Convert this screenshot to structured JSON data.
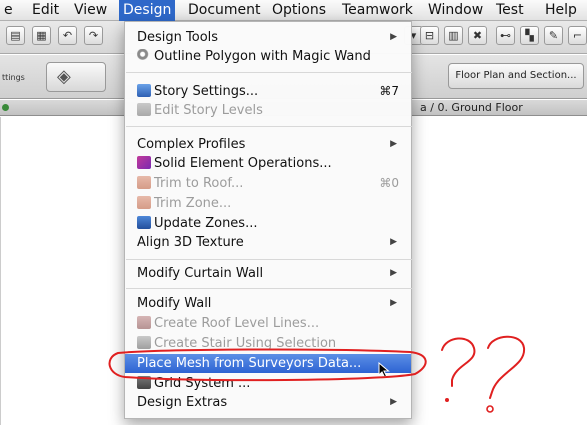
{
  "menubar": {
    "items": [
      "e",
      "Edit",
      "View",
      "Design",
      "Document",
      "Options",
      "Teamwork",
      "Window",
      "Test",
      "Help"
    ],
    "active": "Design"
  },
  "toolbar": {
    "settings_label": "ttings",
    "floor_plan_button": "Floor Plan and Section..."
  },
  "pathbar": {
    "path": "a / 0. Ground Floor"
  },
  "design_menu": {
    "items": [
      {
        "label": "Design Tools",
        "submenu": true,
        "enabled": true
      },
      {
        "label": "Outline Polygon with Magic Wand",
        "icon": "magic-wand-icon",
        "enabled": true
      },
      {
        "label": "Story Settings...",
        "shortcut": "⌘7",
        "icon": "story-settings-icon",
        "enabled": true
      },
      {
        "label": "Edit Story Levels",
        "icon": "edit-story-levels-icon",
        "enabled": false
      },
      {
        "label": "Complex Profiles",
        "submenu": true,
        "enabled": true
      },
      {
        "label": "Solid Element Operations...",
        "icon": "solid-element-icon",
        "enabled": true
      },
      {
        "label": "Trim to Roof...",
        "shortcut": "⌘0",
        "icon": "trim-roof-icon",
        "enabled": false
      },
      {
        "label": "Trim Zone...",
        "icon": "trim-zone-icon",
        "enabled": false
      },
      {
        "label": "Update Zones...",
        "icon": "update-zones-icon",
        "enabled": true
      },
      {
        "label": "Align 3D Texture",
        "submenu": true,
        "enabled": true
      },
      {
        "label": "Modify Curtain Wall",
        "submenu": true,
        "enabled": true
      },
      {
        "label": "Modify Wall",
        "submenu": true,
        "enabled": true
      },
      {
        "label": "Create Roof Level Lines...",
        "icon": "roof-level-icon",
        "enabled": false
      },
      {
        "label": "Create Stair Using Selection",
        "icon": "stair-icon",
        "enabled": false
      },
      {
        "label": "Place Mesh from Surveyors Data...",
        "enabled": true,
        "selected": true
      },
      {
        "label": "Grid System ...",
        "icon": "grid-system-icon",
        "enabled": true
      },
      {
        "label": "Design Extras",
        "submenu": true,
        "enabled": true
      }
    ]
  },
  "annotation": {
    "color": "#e02020",
    "marks": "??"
  }
}
